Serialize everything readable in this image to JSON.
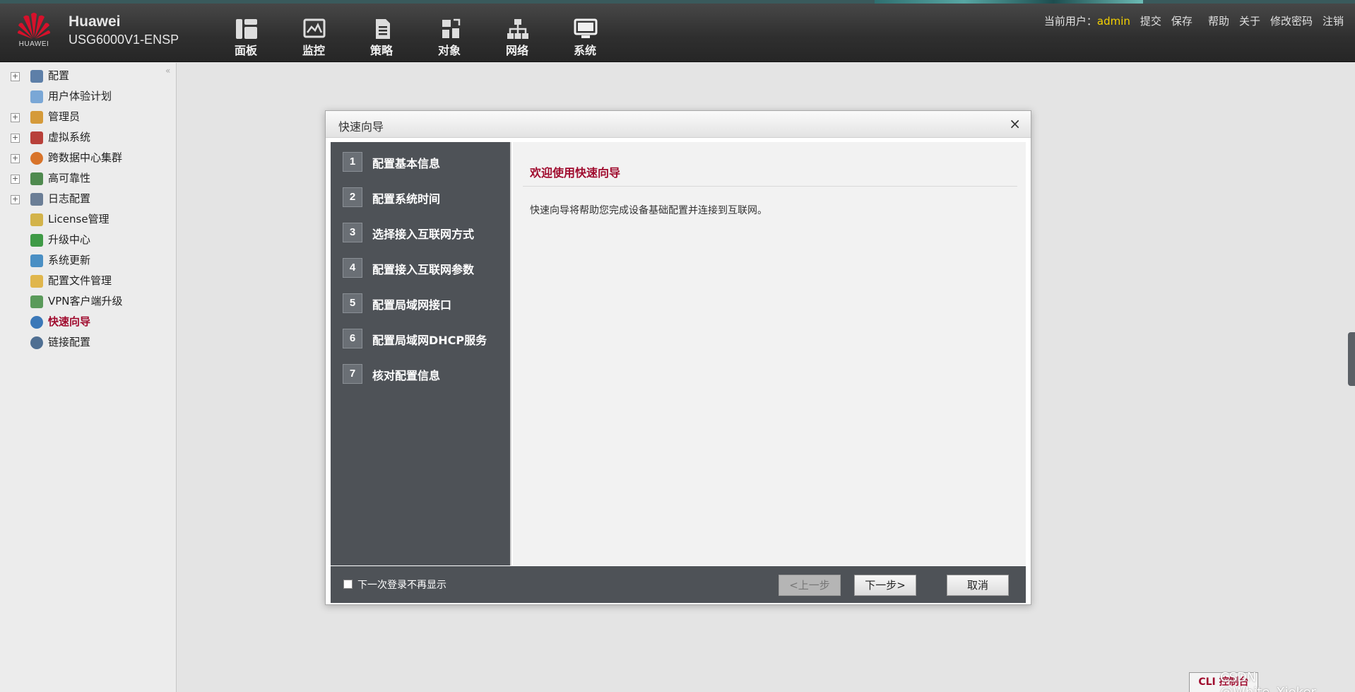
{
  "header": {
    "logo_text": "HUAWEI",
    "brand_name": "Huawei",
    "device_model": "USG6000V1-ENSP",
    "nav": [
      {
        "label": "面板",
        "icon": "dashboard-icon"
      },
      {
        "label": "监控",
        "icon": "monitor-icon"
      },
      {
        "label": "策略",
        "icon": "policy-icon"
      },
      {
        "label": "对象",
        "icon": "object-icon"
      },
      {
        "label": "网络",
        "icon": "network-icon"
      },
      {
        "label": "系统",
        "icon": "system-icon"
      }
    ],
    "current_user_label": "当前用户：",
    "current_user": "admin",
    "links": {
      "commit": "提交",
      "save": "保存",
      "help": "帮助",
      "about": "关于",
      "change_password": "修改密码",
      "logout": "注销"
    }
  },
  "sidebar": {
    "collapse_symbol": "«",
    "items": [
      {
        "label": "配置",
        "expandable": true,
        "icon": "config-icon"
      },
      {
        "label": "用户体验计划",
        "expandable": false,
        "icon": "user-experience-icon"
      },
      {
        "label": "管理员",
        "expandable": true,
        "icon": "admin-icon"
      },
      {
        "label": "虚拟系统",
        "expandable": true,
        "icon": "virtual-system-icon"
      },
      {
        "label": "跨数据中心集群",
        "expandable": true,
        "icon": "cluster-icon"
      },
      {
        "label": "高可靠性",
        "expandable": true,
        "icon": "high-availability-icon"
      },
      {
        "label": "日志配置",
        "expandable": true,
        "icon": "log-config-icon"
      },
      {
        "label": "License管理",
        "expandable": false,
        "icon": "license-icon"
      },
      {
        "label": "升级中心",
        "expandable": false,
        "icon": "upgrade-icon"
      },
      {
        "label": "系统更新",
        "expandable": false,
        "icon": "system-update-icon"
      },
      {
        "label": "配置文件管理",
        "expandable": false,
        "icon": "config-file-icon"
      },
      {
        "label": "VPN客户端升级",
        "expandable": false,
        "icon": "vpn-client-icon"
      },
      {
        "label": "快速向导",
        "expandable": false,
        "icon": "quick-wizard-icon",
        "active": true
      },
      {
        "label": "链接配置",
        "expandable": false,
        "icon": "link-config-icon"
      }
    ]
  },
  "dialog": {
    "title": "快速向导",
    "close_symbol": "×",
    "steps": [
      {
        "num": "1",
        "label": "配置基本信息"
      },
      {
        "num": "2",
        "label": "配置系统时间"
      },
      {
        "num": "3",
        "label": "选择接入互联网方式"
      },
      {
        "num": "4",
        "label": "配置接入互联网参数"
      },
      {
        "num": "5",
        "label": "配置局域网接口"
      },
      {
        "num": "6",
        "label": "配置局域网DHCP服务"
      },
      {
        "num": "7",
        "label": "核对配置信息"
      }
    ],
    "welcome": "欢迎使用快速向导",
    "description": "快速向导将帮助您完成设备基础配置并连接到互联网。",
    "footer": {
      "checkbox_label": "下一次登录不再显示",
      "prev": "<上一步",
      "next": "下一步>",
      "cancel": "取消"
    }
  },
  "cli_tab": "CLI 控制台",
  "watermark": "CSDN @White_Xjoker",
  "colors": {
    "accent_red": "#a00b2e",
    "username_yellow": "#f5d100",
    "topbar": "#2f2f2f",
    "step_panel": "#4e5257"
  }
}
